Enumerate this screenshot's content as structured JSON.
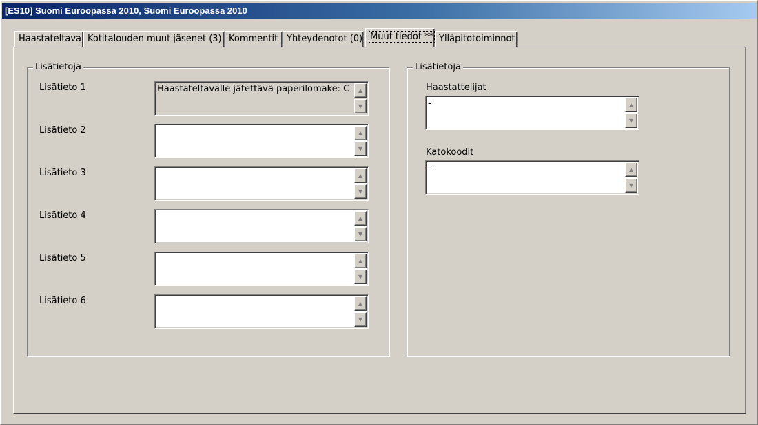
{
  "window": {
    "title": "[ES10] Suomi Euroopassa 2010, Suomi Euroopassa 2010"
  },
  "tabs": [
    {
      "label": "Haastateltava"
    },
    {
      "label": "Kotitalouden muut jäsenet (3)"
    },
    {
      "label": "Kommentit"
    },
    {
      "label": "Yhteydenotot (0)"
    },
    {
      "label": "Muut tiedot **",
      "active": true
    },
    {
      "label": "Ylläpitotoiminnot"
    }
  ],
  "left_group": {
    "title": "Lisätietoja",
    "fields": [
      {
        "label": "Lisätieto 1",
        "value": "Haastateltavalle jätettävä paperilomake:  C",
        "readonly": true
      },
      {
        "label": "Lisätieto 2",
        "value": ""
      },
      {
        "label": "Lisätieto 3",
        "value": ""
      },
      {
        "label": "Lisätieto 4",
        "value": ""
      },
      {
        "label": "Lisätieto 5",
        "value": ""
      },
      {
        "label": "Lisätieto 6",
        "value": ""
      }
    ]
  },
  "right_group": {
    "title": "Lisätietoja",
    "fields": [
      {
        "label": "Haastattelijat",
        "value": "-"
      },
      {
        "label": "Katokoodit",
        "value": "-"
      }
    ]
  },
  "icons": {
    "scroll_up": "triangle-up",
    "scroll_down": "triangle-down"
  }
}
